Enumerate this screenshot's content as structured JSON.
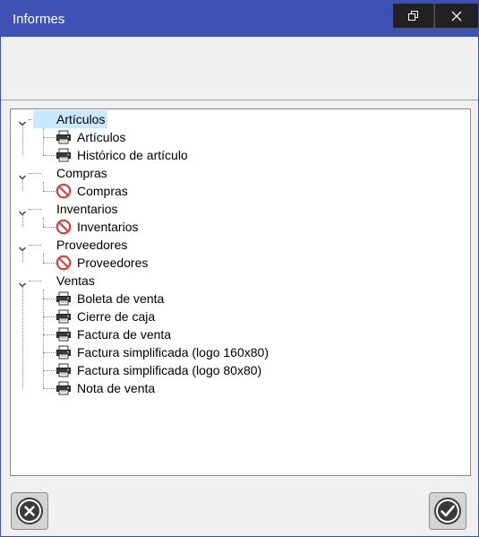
{
  "window": {
    "title": "Informes",
    "restore_label": "restore",
    "close_label": "close"
  },
  "tree": {
    "groups": [
      {
        "label": "Artículos",
        "selected": true,
        "children": [
          {
            "label": "Artículos",
            "icon": "printer-icon"
          },
          {
            "label": "Histórico de artículo",
            "icon": "printer-icon"
          }
        ]
      },
      {
        "label": "Compras",
        "children": [
          {
            "label": "Compras",
            "icon": "forbidden-icon"
          }
        ]
      },
      {
        "label": "Inventarios",
        "children": [
          {
            "label": "Inventarios",
            "icon": "forbidden-icon"
          }
        ]
      },
      {
        "label": "Proveedores",
        "children": [
          {
            "label": "Proveedores",
            "icon": "forbidden-icon"
          }
        ]
      },
      {
        "label": "Ventas",
        "children": [
          {
            "label": "Boleta de venta",
            "icon": "printer-icon"
          },
          {
            "label": "Cierre de caja",
            "icon": "printer-icon"
          },
          {
            "label": "Factura de venta",
            "icon": "printer-icon"
          },
          {
            "label": "Factura simplificada (logo 160x80)",
            "icon": "printer-icon"
          },
          {
            "label": "Factura simplificada (logo 80x80)",
            "icon": "printer-icon"
          },
          {
            "label": "Nota de venta",
            "icon": "printer-icon"
          }
        ]
      }
    ]
  },
  "footer": {
    "cancel_icon": "cancel-icon",
    "accept_icon": "accept-icon"
  },
  "colors": {
    "titlebar": "#3f51b5",
    "selection": "#cce8ff",
    "forbidden": "#e53935"
  }
}
